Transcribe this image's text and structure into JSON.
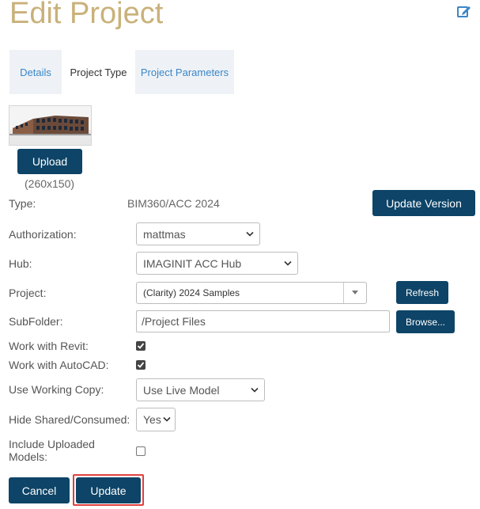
{
  "header": {
    "title": "Edit Project"
  },
  "tabs": [
    {
      "label": "Details"
    },
    {
      "label": "Project Type"
    },
    {
      "label": "Project Parameters"
    }
  ],
  "upload": {
    "button_label": "Upload",
    "dimensions_hint": "(260x150)"
  },
  "form": {
    "type": {
      "label": "Type:",
      "value": "BIM360/ACC 2024",
      "button_label": "Update Version"
    },
    "authorization": {
      "label": "Authorization:",
      "value": "mattmas"
    },
    "hub": {
      "label": "Hub:",
      "value": "IMAGINIT ACC Hub"
    },
    "project": {
      "label": "Project:",
      "value": "(Clarity) 2024 Samples",
      "button_label": "Refresh"
    },
    "subfolder": {
      "label": "SubFolder:",
      "value": "/Project Files",
      "button_label": "Browse..."
    },
    "work_with_revit": {
      "label": "Work with Revit:",
      "checked": true
    },
    "work_with_autocad": {
      "label": "Work with AutoCAD:",
      "checked": true
    },
    "use_working_copy": {
      "label": "Use Working Copy:",
      "value": "Use Live Model"
    },
    "hide_shared": {
      "label": "Hide Shared/Consumed:",
      "value": "Yes"
    },
    "include_uploaded": {
      "label_line1": "Include Uploaded",
      "label_line2": "Models:",
      "checked": false
    }
  },
  "actions": {
    "cancel_label": "Cancel",
    "update_label": "Update"
  },
  "colors": {
    "title": "#c9b17a",
    "primary_button": "#0d4467",
    "tab_link": "#3b86c6",
    "highlight": "#e04040"
  }
}
